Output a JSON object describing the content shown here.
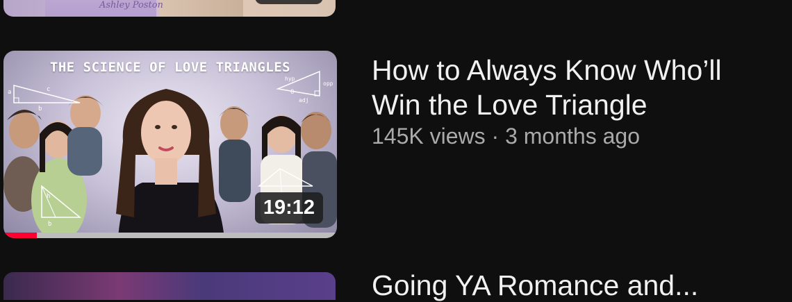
{
  "previous_item": {
    "author_text": "Ashley Poston"
  },
  "video": {
    "thumbnail_title": "THE SCIENCE OF LOVE TRIANGLES",
    "duration": "19:12",
    "title_line1": "How to Always Know Who’ll",
    "title_line2": "Win the Love Triangle",
    "meta": "145K views · 3 months ago",
    "watch_progress_percent": 10,
    "triangle_labels": {
      "a": "a",
      "b": "b",
      "c": "c",
      "hyp": "hyp",
      "opp": "opp",
      "adj": "adj",
      "theta": "θ",
      "h": "h"
    }
  },
  "next_item": {
    "title_partial": "Going YA Romance and..."
  },
  "colors": {
    "background": "#0f0f0f",
    "title_text": "#f1f1f1",
    "meta_text": "#aaaaaa",
    "progress": "#ff0033"
  }
}
